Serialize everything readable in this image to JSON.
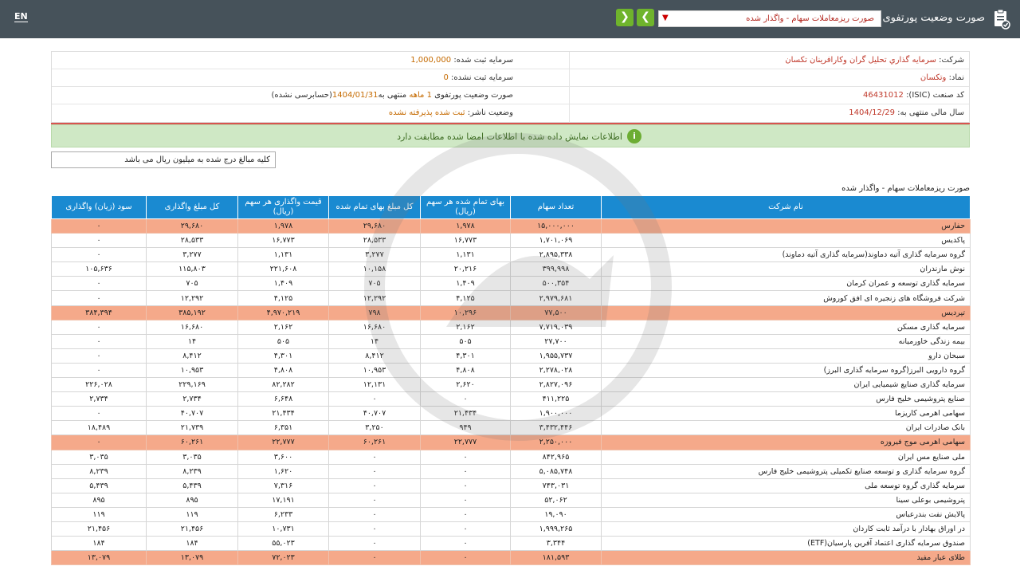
{
  "topbar": {
    "lang": "EN",
    "title": "صورت وضعیت پورتفوی",
    "select_value": "صورت ریزمعاملات سهام - واگذار شده",
    "icons": [
      "report-icon",
      "chevron-down-icon",
      "arrow-right-icon",
      "arrow-left-icon"
    ]
  },
  "info": {
    "company_label": "شرکت:",
    "company_value": "سرمايه گذاري تحليل گران وكارافرينان تكسان",
    "registered_capital_label": "سرمایه ثبت شده:",
    "registered_capital_value": "1,000,000",
    "symbol_label": "نماد:",
    "symbol_value": "وتكسان",
    "unregistered_capital_label": "سرمایه ثبت نشده:",
    "unregistered_capital_value": "0",
    "isic_label": "کد صنعت (ISIC):",
    "isic_value": "46431012",
    "report_label": "صورت وضعیت پورتفوی",
    "report_months": "1 ماهه",
    "report_period_prefix": "منتهی به",
    "report_period_date": "1404/01/31",
    "report_audit": "(حسابرسی نشده)",
    "fiscal_label": "سال مالی منتهی به:",
    "fiscal_value": "1404/12/29",
    "publisher_label": "وضعیت ناشر:",
    "publisher_value": "ثبت شده پذیرفته نشده"
  },
  "alert": {
    "icon": "info-icon",
    "text": "اطلاعات نمایش داده شده با اطلاعات امضا شده مطابقت دارد"
  },
  "unit_note": "کلیه مبالغ درج شده به میلیون ریال می باشد",
  "section_title": "صورت ریزمعاملات سهام - واگذار شده",
  "table": {
    "headers": [
      "نام شرکت",
      "تعداد سهام",
      "بهای تمام شده هر سهم (ریال)",
      "کل مبلغ بهای تمام شده",
      "قیمت واگذاری هر سهم (ریال)",
      "کل مبلغ واگذاری",
      "سود (زیان) واگذاری"
    ],
    "rows": [
      {
        "hl": true,
        "c": [
          "حفارس",
          "۱۵,۰۰۰,۰۰۰",
          "۱,۹۷۸",
          "۲۹,۶۸۰",
          "۱,۹۷۸",
          "۲۹,۶۸۰",
          "۰"
        ]
      },
      {
        "hl": false,
        "c": [
          "پاکدیس",
          "۱,۷۰۱,۰۶۹",
          "۱۶,۷۷۳",
          "۲۸,۵۳۳",
          "۱۶,۷۷۳",
          "۲۸,۵۳۳",
          "۰"
        ]
      },
      {
        "hl": false,
        "c": [
          "گروه سرمایه گذاری آتیه دماوند(سرمایه گذاری آتیه دماوند)",
          "۲,۸۹۵,۳۳۸",
          "۱,۱۳۱",
          "۳,۲۷۷",
          "۱,۱۳۱",
          "۳,۲۷۷",
          "۰"
        ]
      },
      {
        "hl": false,
        "c": [
          "نوش مازندران",
          "۳۹۹,۹۹۸",
          "۲۰,۲۱۶",
          "۱۰,۱۵۸",
          "۲۲۱,۶۰۸",
          "۱۱۵,۸۰۳",
          "۱۰۵,۶۳۶"
        ]
      },
      {
        "hl": false,
        "c": [
          "سرمایه گذاری توسعه و عمران کرمان",
          "۵۰۰,۳۵۴",
          "۱,۴۰۹",
          "۷۰۵",
          "۱,۴۰۹",
          "۷۰۵",
          "۰"
        ]
      },
      {
        "hl": false,
        "c": [
          "شرکت فروشگاه های زنجیره ای افق کوروش",
          "۲,۹۷۹,۶۸۱",
          "۴,۱۲۵",
          "۱۲,۲۹۲",
          "۴,۱۲۵",
          "۱۲,۲۹۲",
          "۰"
        ]
      },
      {
        "hl": true,
        "c": [
          "تپردیس",
          "۷۷,۵۰۰",
          "۱۰,۲۹۶",
          "۷۹۸",
          "۴,۹۷۰,۲۱۹",
          "۳۸۵,۱۹۲",
          "۳۸۴,۳۹۴"
        ]
      },
      {
        "hl": false,
        "c": [
          "سرمایه گذاری مسکن",
          "۷,۷۱۹,۰۳۹",
          "۲,۱۶۲",
          "۱۶,۶۸۰",
          "۲,۱۶۲",
          "۱۶,۶۸۰",
          "۰"
        ]
      },
      {
        "hl": false,
        "c": [
          "بیمه زندگی خاورمیانه",
          "۲۷,۷۰۰",
          "۵۰۵",
          "۱۴",
          "۵۰۵",
          "۱۴",
          "۰"
        ]
      },
      {
        "hl": false,
        "c": [
          "سبحان دارو",
          "۱,۹۵۵,۷۳۷",
          "۴,۳۰۱",
          "۸,۴۱۲",
          "۴,۳۰۱",
          "۸,۴۱۲",
          "۰"
        ]
      },
      {
        "hl": false,
        "c": [
          "گروه دارویی البرز(گروه سرمایه گذاری البرز)",
          "۲,۲۷۸,۰۲۸",
          "۴,۸۰۸",
          "۱۰,۹۵۳",
          "۴,۸۰۸",
          "۱۰,۹۵۳",
          "۰"
        ]
      },
      {
        "hl": false,
        "c": [
          "سرمایه گذاری صنایع شیمیایی ایران",
          "۲,۸۲۷,۰۹۶",
          "۲,۶۲۰",
          "۱۲,۱۳۱",
          "۸۲,۲۸۲",
          "۲۲۹,۱۶۹",
          "۲۲۶,۰۲۸"
        ]
      },
      {
        "hl": false,
        "c": [
          "صنایع پتروشیمی خلیج فارس",
          "۴۱۱,۲۲۵",
          "۰",
          "۰",
          "۶,۶۴۸",
          "۲,۷۳۴",
          "۲,۷۳۴"
        ]
      },
      {
        "hl": false,
        "c": [
          "سهامی اهرمی کاریزما",
          "۱,۹۰۰,۰۰۰",
          "۲۱,۴۳۴",
          "۴۰,۷۰۷",
          "۲۱,۴۳۴",
          "۴۰,۷۰۷",
          "۰"
        ]
      },
      {
        "hl": false,
        "c": [
          "بانک صادرات ایران",
          "۳,۴۳۲,۴۴۶",
          "۹۴۹",
          "۳,۲۵۰",
          "۶,۳۵۱",
          "۲۱,۷۳۹",
          "۱۸,۴۸۹"
        ]
      },
      {
        "hl": true,
        "c": [
          "سهامی اهرمی موج فیروزه",
          "۲,۲۵۰,۰۰۰",
          "۲۲,۷۷۷",
          "۶۰,۲۶۱",
          "۲۲,۷۷۷",
          "۶۰,۲۶۱",
          "۰"
        ]
      },
      {
        "hl": false,
        "c": [
          "ملی صنایع مس ایران",
          "۸۴۲,۹۶۵",
          "۰",
          "۰",
          "۳,۶۰۰",
          "۳,۰۳۵",
          "۳,۰۳۵"
        ]
      },
      {
        "hl": false,
        "c": [
          "گروه سرمایه گذاری و توسعه صنایع تکمیلی پتروشیمی خلیج فارس",
          "۵,۰۸۵,۷۴۸",
          "۰",
          "۰",
          "۱,۶۲۰",
          "۸,۲۳۹",
          "۸,۲۳۹"
        ]
      },
      {
        "hl": false,
        "c": [
          "سرمایه گذاری گروه توسعه ملی",
          "۷۴۳,۰۳۱",
          "۰",
          "۰",
          "۷,۳۱۶",
          "۵,۴۳۹",
          "۵,۴۳۹"
        ]
      },
      {
        "hl": false,
        "c": [
          "پتروشیمی بوعلی سینا",
          "۵۲,۰۶۲",
          "۰",
          "۰",
          "۱۷,۱۹۱",
          "۸۹۵",
          "۸۹۵"
        ]
      },
      {
        "hl": false,
        "c": [
          "پالایش نفت بندرعباس",
          "۱۹,۰۹۰",
          "۰",
          "۰",
          "۶,۲۳۳",
          "۱۱۹",
          "۱۱۹"
        ]
      },
      {
        "hl": false,
        "c": [
          "در اوراق بهادار با درآمد ثابت کاردان",
          "۱,۹۹۹,۲۶۵",
          "۰",
          "۰",
          "۱۰,۷۳۱",
          "۲۱,۴۵۶",
          "۲۱,۴۵۶"
        ]
      },
      {
        "hl": false,
        "c": [
          "صندوق سرمایه گذاری اعتماد آفرین پارسیان(ETF)",
          "۳,۳۴۴",
          "۰",
          "۰",
          "۵۵,۰۲۳",
          "۱۸۴",
          "۱۸۴"
        ]
      },
      {
        "hl": true,
        "c": [
          "طلای عیار مفید",
          "۱۸۱,۵۹۳",
          "۰",
          "۰",
          "۷۲,۰۲۳",
          "۱۳,۰۷۹",
          "۱۳,۰۷۹"
        ]
      }
    ]
  },
  "colors": {
    "topbar": "#46525a",
    "header": "#1a8ad1",
    "highlight": "#f5a98a",
    "alert_bg": "#cfe8c5",
    "nav_button": "#6fb42c"
  }
}
